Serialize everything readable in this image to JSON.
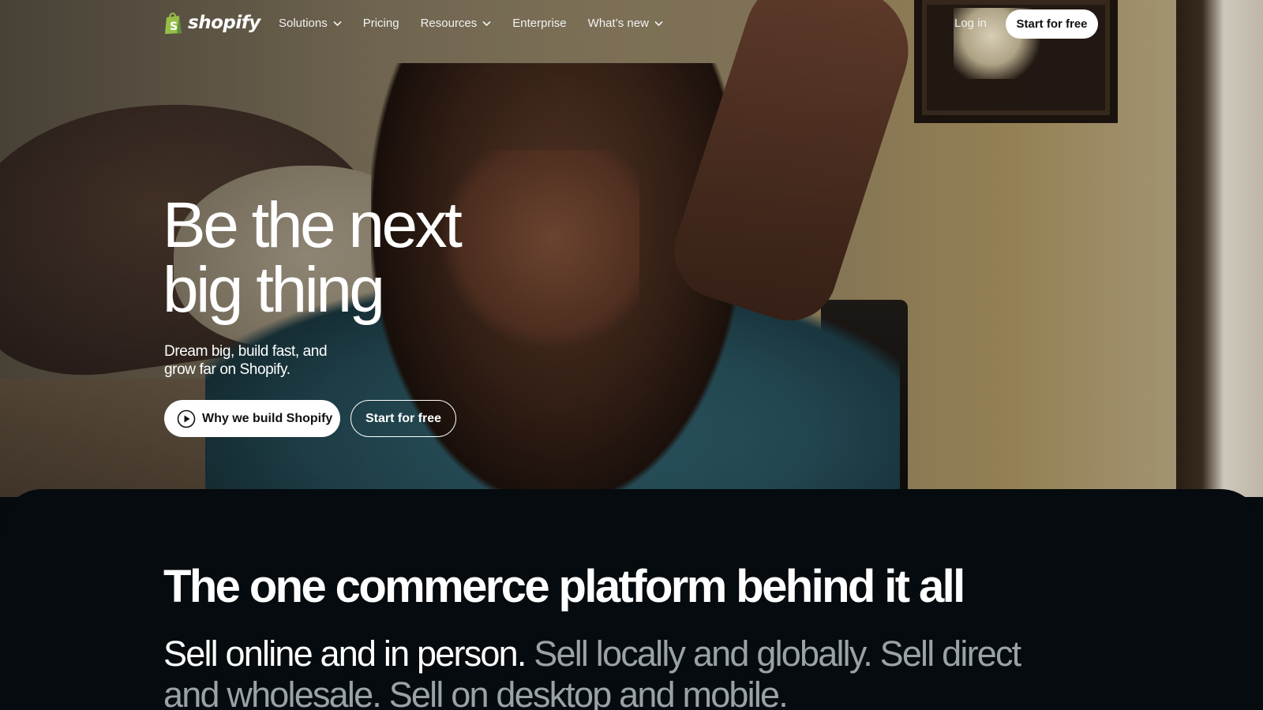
{
  "brand": {
    "name": "shopify",
    "accent": "#95bf47"
  },
  "nav": {
    "items": [
      {
        "label": "Solutions",
        "dropdown": true
      },
      {
        "label": "Pricing",
        "dropdown": false
      },
      {
        "label": "Resources",
        "dropdown": true
      },
      {
        "label": "Enterprise",
        "dropdown": false
      },
      {
        "label": "What’s new",
        "dropdown": true
      }
    ],
    "login": "Log in",
    "cta": "Start for free"
  },
  "hero": {
    "title_line1": "Be the next",
    "title_line2": "big thing",
    "subtitle_line1": "Dream big, build fast, and",
    "subtitle_line2": "grow far on Shopify.",
    "primary_button": "Why we build Shopify",
    "primary_button_icon": "play-icon",
    "secondary_button": "Start for free"
  },
  "section": {
    "title": "The one commerce platform behind it all",
    "highlight": "Sell online and in person.",
    "muted": " Sell locally and globally. Sell direct and wholesale. Sell on desktop and mobile."
  }
}
